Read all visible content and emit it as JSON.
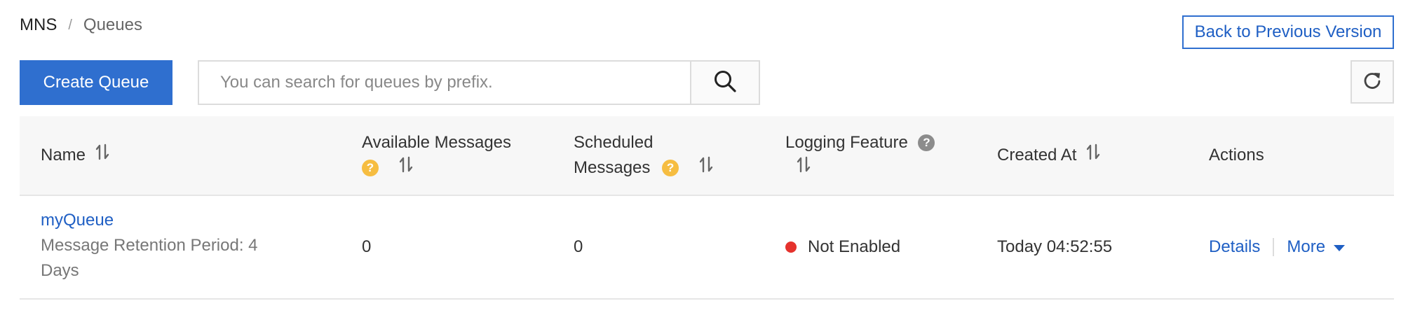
{
  "breadcrumb": {
    "root": "MNS",
    "separator": "/",
    "current": "Queues"
  },
  "toolbar": {
    "back_label": "Back to Previous Version",
    "create_label": "Create Queue",
    "search_placeholder": "You can search for queues by prefix.",
    "search_value": ""
  },
  "table": {
    "columns": {
      "name": "Name",
      "available_line1": "Available Messages",
      "scheduled_line1": "Scheduled",
      "scheduled_line2": "Messages",
      "logging": "Logging Feature",
      "created": "Created At",
      "actions": "Actions"
    },
    "rows": [
      {
        "name": "myQueue",
        "retention": "Message Retention Period: 4 Days",
        "available": "0",
        "scheduled": "0",
        "logging": "Not Enabled",
        "created": "Today 04:52:55",
        "action_details": "Details",
        "action_more": "More"
      }
    ]
  },
  "colors": {
    "primary": "#2f6fcf",
    "link": "#1f5fc4",
    "help_yellow": "#f6bd41",
    "status_red": "#e5322d"
  }
}
